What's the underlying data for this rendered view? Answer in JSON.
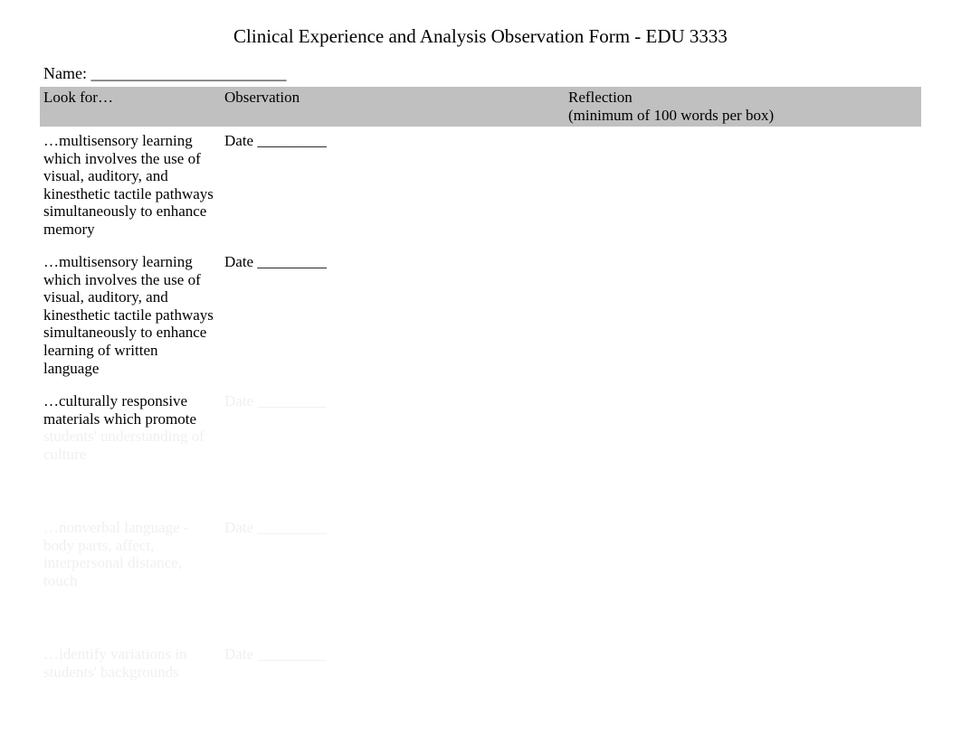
{
  "title": "Clinical Experience and Analysis Observation Form - EDU 3333",
  "name_label": "Name: ________________________",
  "headers": {
    "col1": "Look for…",
    "col2": "Observation",
    "col3_line1": "Reflection",
    "col3_line2": "(minimum of 100 words per box)"
  },
  "date_label": "Date _________",
  "rows": [
    {
      "lookfor": "…multisensory learning which\ninvolves the use of visual, auditory, and kinesthetic tactile pathways simultaneously to enhance memory"
    },
    {
      "lookfor": "…multisensory learning which\ninvolves the use of visual, auditory, and kinesthetic tactile pathways simultaneously to\nenhance learning of written language"
    },
    {
      "lookfor": "…culturally responsive materials which promote students' understanding of culture"
    },
    {
      "lookfor": "…nonverbal language - body parts, affect, interpersonal distance, touch"
    },
    {
      "lookfor": "…identify variations in students' backgrounds"
    }
  ]
}
